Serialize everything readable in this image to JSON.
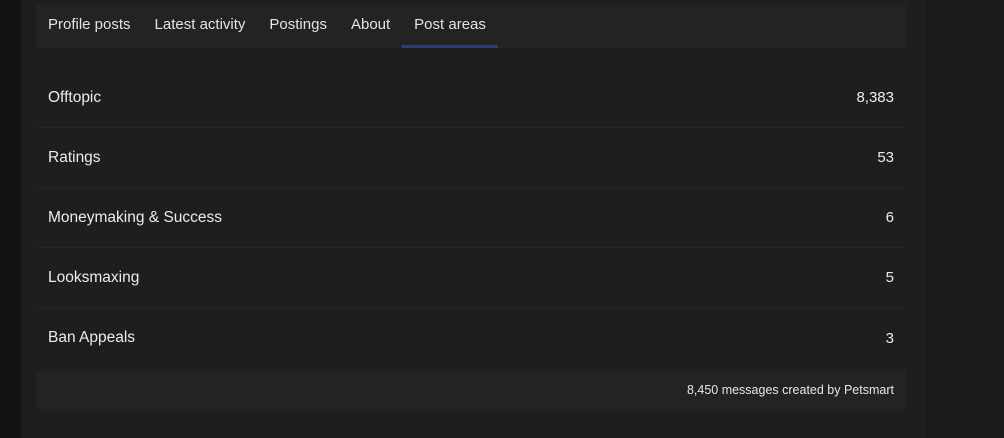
{
  "tabs": [
    {
      "label": "Profile posts",
      "active": false
    },
    {
      "label": "Latest activity",
      "active": false
    },
    {
      "label": "Postings",
      "active": false
    },
    {
      "label": "About",
      "active": false
    },
    {
      "label": "Post areas",
      "active": true
    }
  ],
  "post_areas": [
    {
      "label": "Offtopic",
      "count": "8,383"
    },
    {
      "label": "Ratings",
      "count": "53"
    },
    {
      "label": "Moneymaking & Success",
      "count": "6"
    },
    {
      "label": "Looksmaxing",
      "count": "5"
    },
    {
      "label": "Ban Appeals",
      "count": "3"
    }
  ],
  "footer": {
    "summary": "8,450 messages created by Petsmart"
  },
  "colors": {
    "background": "#1b1b1b",
    "panel": "#1e1e1e",
    "tab_bar": "#232323",
    "active_tab_underline": "#2f3f73",
    "text": "#ececec"
  }
}
